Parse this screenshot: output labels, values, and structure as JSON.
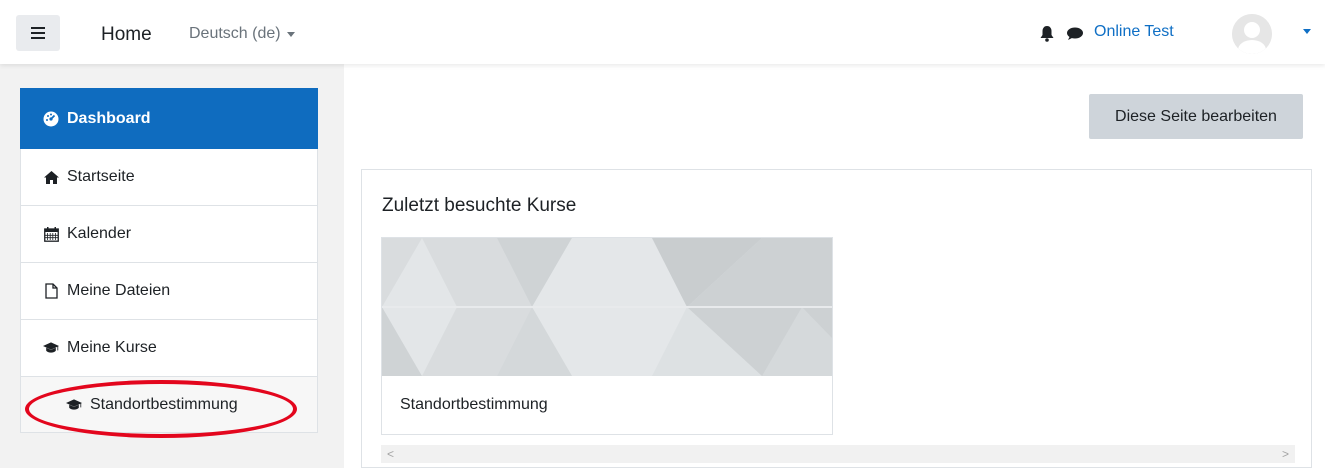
{
  "navbar": {
    "home_label": "Home",
    "language": "Deutsch (de)",
    "user_name": "Online Test"
  },
  "sidebar": {
    "items": [
      {
        "label": "Dashboard",
        "icon": "dashboard-icon",
        "active": true
      },
      {
        "label": "Startseite",
        "icon": "home-icon"
      },
      {
        "label": "Kalender",
        "icon": "calendar-icon"
      },
      {
        "label": "Meine Dateien",
        "icon": "file-icon"
      },
      {
        "label": "Meine Kurse",
        "icon": "graduation-cap-icon"
      },
      {
        "label": "Standortbestimmung",
        "icon": "graduation-cap-icon"
      }
    ]
  },
  "main": {
    "edit_button": "Diese Seite bearbeiten",
    "block_title": "Zuletzt besuchte Kurse",
    "course_card_name": "Standortbestimmung",
    "scroll_left": "<",
    "scroll_right": ">"
  },
  "colors": {
    "primary": "#0f6cbf",
    "link": "#0f6fc5",
    "highlight": "#e3061d",
    "button_bg": "#ced4da"
  }
}
